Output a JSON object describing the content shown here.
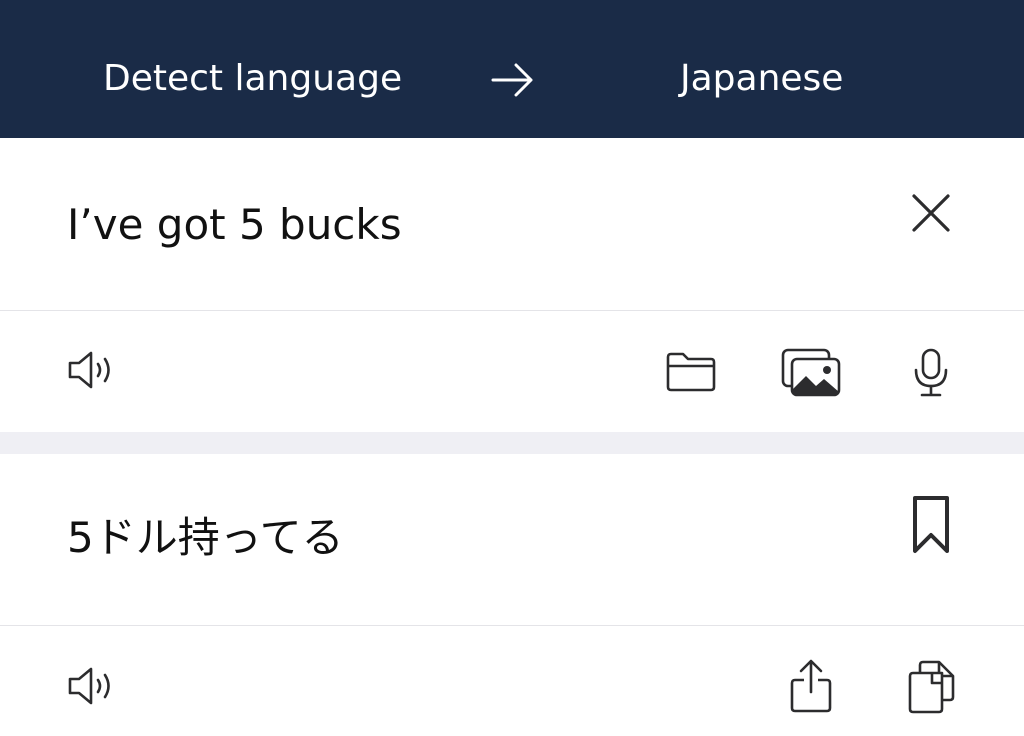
{
  "header": {
    "source_language": "Detect language",
    "target_language": "Japanese",
    "swap_icon": "arrow-right-icon"
  },
  "source": {
    "text": "I’ve got 5 bucks",
    "clear_icon": "close-icon"
  },
  "source_toolbar": {
    "icons": [
      "speaker-icon",
      "folder-icon",
      "photos-icon",
      "microphone-icon"
    ]
  },
  "result": {
    "text": "5ドル持ってる",
    "bookmark_icon": "bookmark-icon"
  },
  "result_toolbar": {
    "icons": [
      "speaker-icon",
      "share-icon",
      "copy-icon"
    ]
  },
  "colors": {
    "header_background": "#1a2b47",
    "header_text": "#ffffff",
    "separator_band": "#efeff4",
    "icon": "#2c2c2e"
  }
}
